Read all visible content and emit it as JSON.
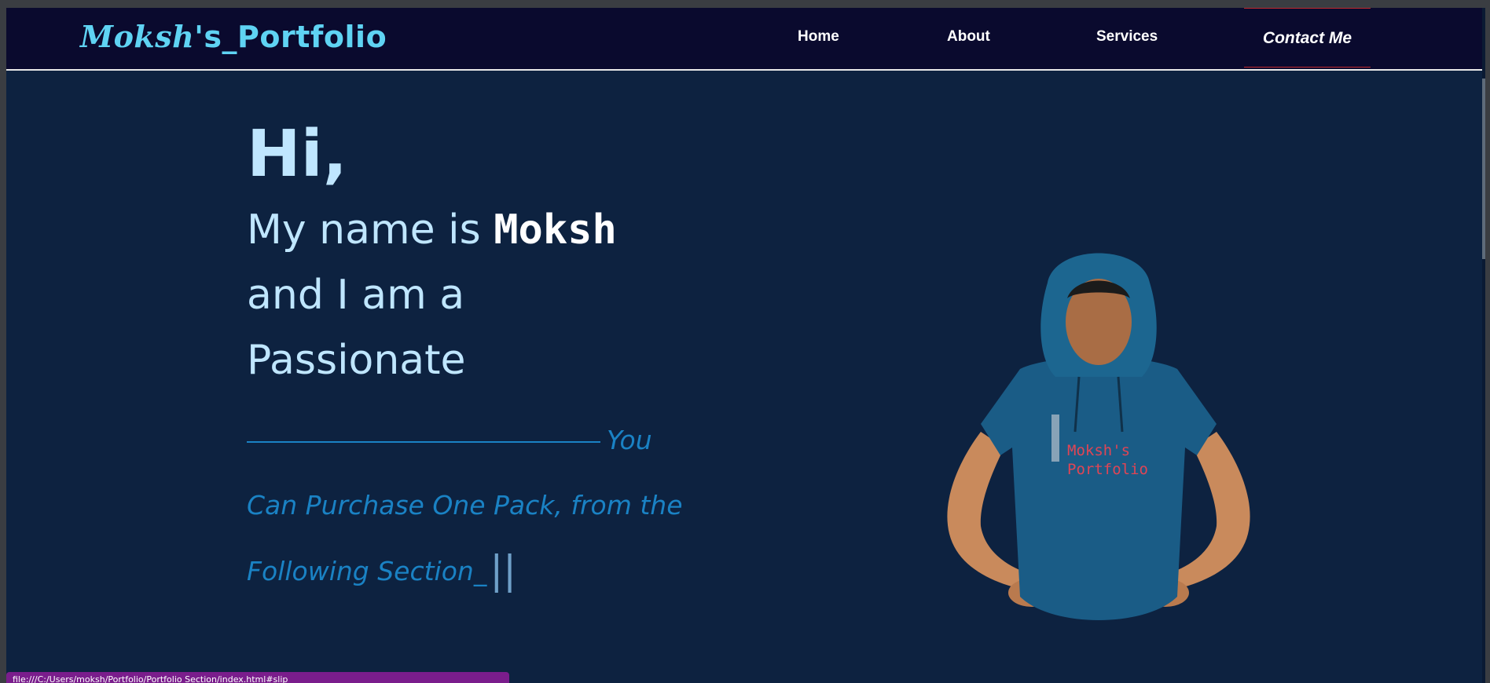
{
  "navbar": {
    "brand_stylized": "Moksh",
    "brand_rest": "'s_Portfolio",
    "items": [
      {
        "label": "Home"
      },
      {
        "label": "About"
      },
      {
        "label": "Services"
      },
      {
        "label": "Contact Me"
      }
    ]
  },
  "hero": {
    "greeting": "Hi,",
    "intro_prefix": "My name is ",
    "name": "Moksh",
    "intro_line2": "and I am a",
    "intro_line3": "Passionate",
    "typing_text": "You Can Purchase One Pack, from the Following Section_",
    "cursor": "||"
  },
  "photo": {
    "shirt_text_line1": "Moksh's",
    "shirt_text_line2": "Portfolio"
  },
  "status_bar": {
    "text": "file:///C:/Users/moksh/Portfolio/Portfolio Section/index.html#slip"
  },
  "colors": {
    "background": "#0d2240",
    "navbar": "#0a0a2e",
    "brand": "#5fd3f3",
    "accent_text": "#bfe6ff",
    "typing": "#1a82c4",
    "contact_border": "#c0282d",
    "status_bar": "#7a1d8c"
  }
}
